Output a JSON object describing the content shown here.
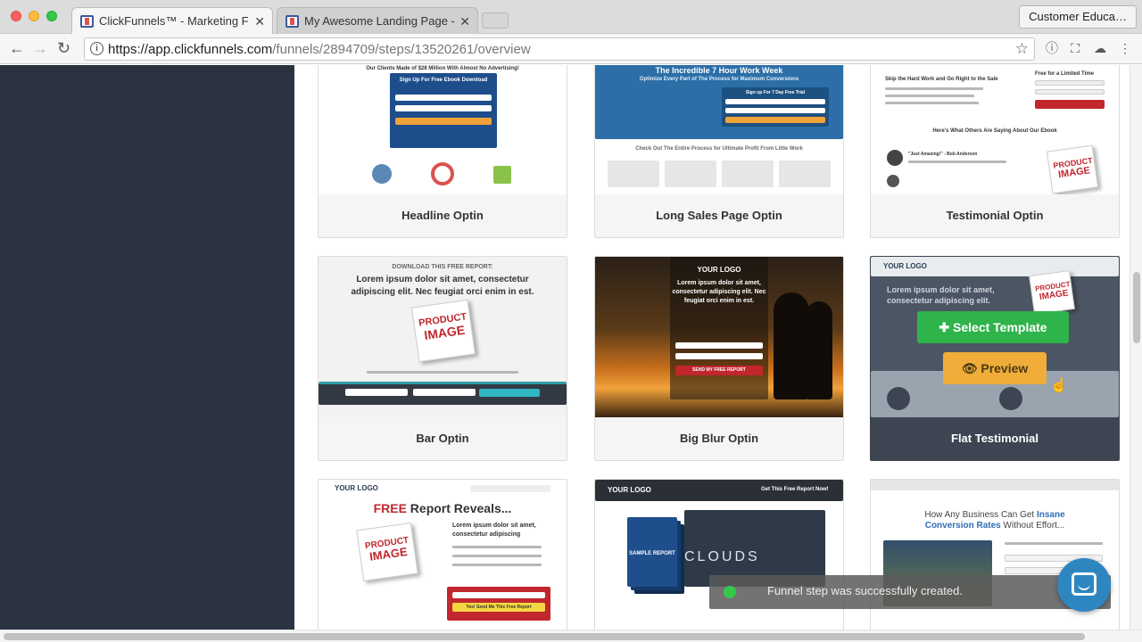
{
  "browser": {
    "tabs": [
      {
        "title": "ClickFunnels™ - Marketing Fu",
        "active": true
      },
      {
        "title": "My Awesome Landing Page - P",
        "active": false
      }
    ],
    "profile_button": "Customer Educa…",
    "url_host": "https://app.clickfunnels.com",
    "url_path": "/funnels/2894709/steps/13520261/overview"
  },
  "templates": [
    {
      "label": "Headline Optin",
      "thumb": {
        "heading": "Our Clients Made of $28 Million With Almost No Advertising!",
        "form_title": "Sign Up For Free Ebook Download"
      }
    },
    {
      "label": "Long Sales Page Optin",
      "thumb": {
        "heading": "The Incredible 7 Hour Work Week",
        "subheading": "Optimize Every Part of The Process for Maximum Conversions",
        "form_title": "Sign up For 7 Day Free Trial",
        "bottom_text": "Check Out The Entire Process for Ultimate Profit From Little Work"
      }
    },
    {
      "label": "Testimonial Optin",
      "thumb": {
        "heading": "Skip the Hard Work and Go Right to the Sale",
        "side_title": "Free for a Limited Time",
        "section": "Here's What Others Are Saying About Our Ebook",
        "quote": "\"Just Amazing!\" - Bob Anderson",
        "product_line1": "PRODUCT",
        "product_line2": "IMAGE"
      }
    },
    {
      "label": "Bar Optin",
      "thumb": {
        "top": "DOWNLOAD THIS FREE REPORT:",
        "line1": "Lorem ipsum dolor sit amet, consectetur",
        "line2": "adipiscing elit. Nec feugiat orci enim in est.",
        "product_line1": "PRODUCT",
        "product_line2": "IMAGE"
      }
    },
    {
      "label": "Big Blur Optin",
      "thumb": {
        "logo": "YOUR LOGO",
        "line1": "Lorem ipsum dolor sit amet,",
        "line2": "consectetur adipiscing elit. Nec",
        "line3": "feugiat orci enim in est.",
        "cta": "SEND MY FREE REPORT"
      }
    },
    {
      "label": "Flat Testimonial",
      "thumb": {
        "logo": "YOUR LOGO",
        "line1": "Lorem ipsum dolor sit amet,",
        "line2": "consectetur adipiscing elit.",
        "product_line1": "PRODUCT",
        "product_line2": "IMAGE"
      },
      "hover": {
        "select": "Select Template",
        "preview": "Preview"
      }
    },
    {
      "label": "",
      "thumb": {
        "logo": "YOUR LOGO",
        "headline_red": "FREE",
        "headline_rest": " Report Reveals...",
        "line1": "Lorem ipsum dolor sit amet,",
        "line2": "consectetur adipiscing",
        "cta": "Yes! Send Me This Free Report",
        "product_line1": "PRODUCT",
        "product_line2": "IMAGE"
      }
    },
    {
      "label": "",
      "thumb": {
        "logo": "YOUR LOGO",
        "right_text": "Get This Free Report Now!",
        "book_text": "SAMPLE REPORT",
        "video_text": "CLOUDS"
      }
    },
    {
      "label": "",
      "thumb": {
        "heading1": "How Any Business Can Get ",
        "heading_blue": "Insane",
        "heading2": "Conversion Rates",
        "heading3": " Without Effort..."
      }
    }
  ],
  "toast": {
    "message": "Funnel step was successfully created."
  },
  "colors": {
    "sidebar": "#2b3340",
    "select_green": "#2fb34b",
    "preview_orange": "#f0ad3a",
    "toast_dot": "#34c84a",
    "chat": "#2e86c1"
  }
}
